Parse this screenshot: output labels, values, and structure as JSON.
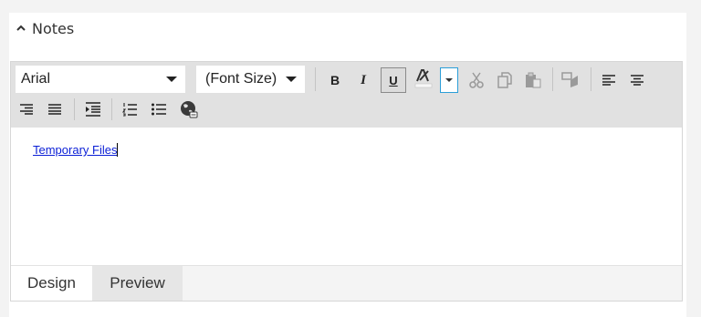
{
  "section": {
    "title": "Notes",
    "icon": "chevron-up-icon"
  },
  "toolbar": {
    "font_name": "Arial",
    "font_size": "(Font Size)",
    "bold_label": "B",
    "italic_label": "I",
    "underline_label": "U"
  },
  "content": {
    "link_text": "Temporary Files"
  },
  "tabs": [
    {
      "label": "Design",
      "active": true
    },
    {
      "label": "Preview",
      "active": false
    }
  ],
  "colors": {
    "link": "#0b1fd6",
    "toolbar_bg": "#e1e1e1",
    "page_bg": "#f3f3f3",
    "focus_border": "#2b9ed8"
  }
}
